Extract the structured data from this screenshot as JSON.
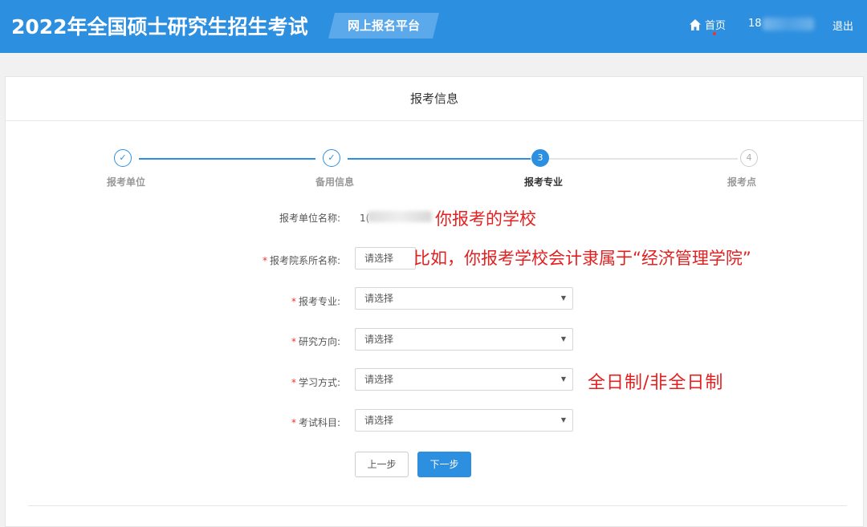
{
  "header": {
    "title": "2022年全国硕士研究生招生考试",
    "platform": "网上报名平台",
    "nav": {
      "home": "首页",
      "user_prefix": "18",
      "logout": "退出"
    }
  },
  "panel": {
    "title": "报考信息"
  },
  "steps": [
    {
      "label": "报考单位",
      "status": "done",
      "mark": "✓"
    },
    {
      "label": "备用信息",
      "status": "done",
      "mark": "✓"
    },
    {
      "label": "报考专业",
      "status": "active",
      "mark": "3"
    },
    {
      "label": "报考点",
      "status": "todo",
      "mark": "4"
    }
  ],
  "form": {
    "unit": {
      "label": "报考单位名称:",
      "value_prefix": "1("
    },
    "department": {
      "label": "报考院系所名称:",
      "placeholder": "请选择"
    },
    "major": {
      "label": "报考专业:",
      "placeholder": "请选择"
    },
    "direction": {
      "label": "研究方向:",
      "placeholder": "请选择"
    },
    "study_mode": {
      "label": "学习方式:",
      "placeholder": "请选择"
    },
    "exam_subjects": {
      "label": "考试科目:",
      "placeholder": "请选择"
    },
    "required_mark": "*"
  },
  "buttons": {
    "prev": "上一步",
    "next": "下一步"
  },
  "annotations": {
    "school": "你报考的学校",
    "department": "比如，你报考学校会计隶属于“经济管理学院”",
    "study_mode": "全日制/非全日制"
  },
  "colors": {
    "primary": "#2d8fe0",
    "annotation": "#e32020",
    "required": "#e33333"
  }
}
